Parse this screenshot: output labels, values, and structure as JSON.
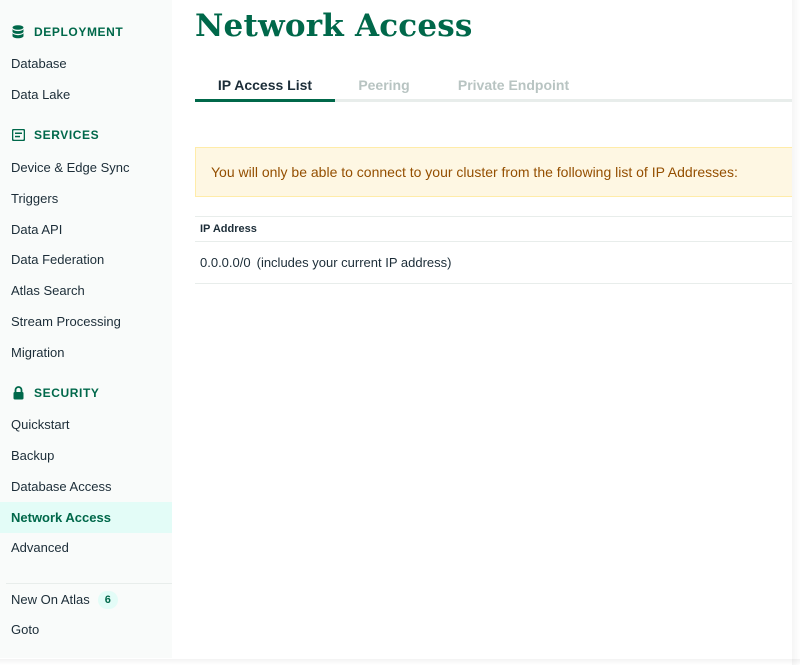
{
  "sidebar": {
    "sections": [
      {
        "title": "DEPLOYMENT",
        "icon": "database-icon",
        "items": [
          "Database",
          "Data Lake"
        ]
      },
      {
        "title": "SERVICES",
        "icon": "services-icon",
        "items": [
          "Device & Edge Sync",
          "Triggers",
          "Data API",
          "Data Federation",
          "Atlas Search",
          "Stream Processing",
          "Migration"
        ]
      },
      {
        "title": "SECURITY",
        "icon": "lock-icon",
        "items": [
          "Quickstart",
          "Backup",
          "Database Access",
          "Network Access",
          "Advanced"
        ]
      }
    ],
    "active_item": "Network Access",
    "footer": {
      "new_on_atlas_label": "New On Atlas",
      "new_on_atlas_count": "6",
      "goto_label": "Goto"
    }
  },
  "main": {
    "title": "Network Access",
    "tabs": [
      {
        "label": "IP Access List",
        "active": true
      },
      {
        "label": "Peering",
        "active": false
      },
      {
        "label": "Private Endpoint",
        "active": false
      }
    ],
    "banner_text": "You will only be able to connect to your cluster from the following list of IP Addresses:",
    "table": {
      "column_header": "IP Address",
      "rows": [
        {
          "ip": "0.0.0.0/0",
          "note": "(includes your current IP address)"
        }
      ]
    }
  },
  "colors": {
    "accent": "#00684a",
    "active_bg": "#e3fcf7",
    "banner_bg": "#fef7e3",
    "banner_text": "#944f01",
    "inactive_tab": "#b8c4c2"
  }
}
